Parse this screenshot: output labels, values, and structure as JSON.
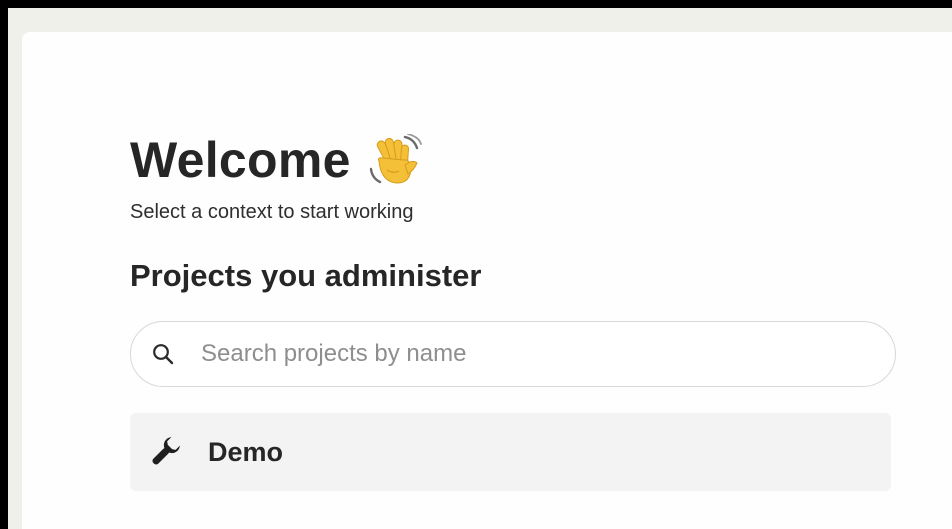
{
  "welcome": {
    "title": "Welcome",
    "emoji_icon": "waving-hand-icon",
    "subtitle": "Select a context to start working"
  },
  "projects": {
    "heading": "Projects you administer",
    "search": {
      "placeholder": "Search projects by name",
      "value": "",
      "icon": "search-icon"
    },
    "items": [
      {
        "name": "Demo",
        "icon": "wrench-icon"
      }
    ]
  },
  "colors": {
    "page_background": "#f0f0eb",
    "panel_background": "#fefefe",
    "text_primary": "#262626",
    "placeholder": "#8e8e8e",
    "item_background": "#f3f3f3",
    "border": "#d8d8d8",
    "wave_yellow": "#f4c038"
  }
}
